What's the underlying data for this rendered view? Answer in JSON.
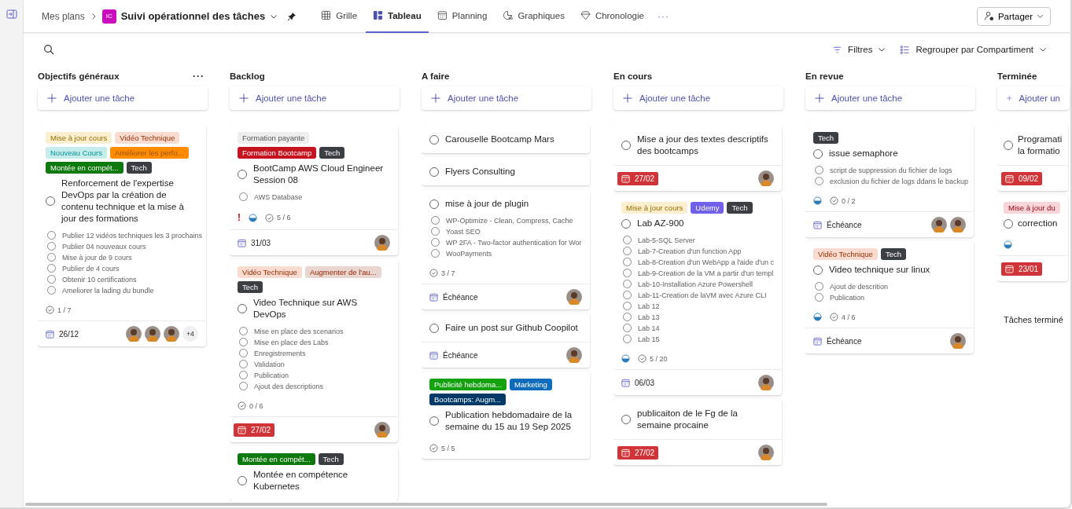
{
  "header": {
    "breadcrumb": "Mes plans",
    "plan_badge": "IC",
    "plan_title": "Suivi opérationnel des tâches",
    "tabs": [
      {
        "label": "Grille",
        "selected": false
      },
      {
        "label": "Tableau",
        "selected": true
      },
      {
        "label": "Planning",
        "selected": false
      },
      {
        "label": "Graphiques",
        "selected": false
      },
      {
        "label": "Chronologie",
        "selected": false
      }
    ],
    "more": "···",
    "share": "Partager"
  },
  "toolbar": {
    "filters": "Filtres",
    "group": "Regrouper par Compartiment"
  },
  "columns": [
    {
      "title": "Objectifs généraux",
      "menu": "···",
      "add": "Ajouter une tâche",
      "cards": [
        {
          "tags": [
            {
              "label": "Mise à jour cours",
              "color": "#fbefcf"
            },
            {
              "label": "Vidéo Technique",
              "color": "#f9dccf"
            },
            {
              "label": "Nouveau Cours",
              "color": "#c6ecec"
            },
            {
              "label": "Améliorer les perfo...",
              "color": "#ff8c00"
            },
            {
              "label": "Montée en compét...",
              "color": "#0e7a0d"
            },
            {
              "label": "Tech",
              "color": "#3b3f44"
            }
          ],
          "checked": false,
          "title": "Renforcement de l'expertise DevOps par la création de contenu technique et la mise à jour des formations",
          "subtasks": [
            {
              "label": "Publier 12 vidéos techniques les 3 prochains",
              "checked": false
            },
            {
              "label": "Publier 04 nouveaux cours",
              "checked": false
            },
            {
              "label": "Mise à jour de 9 cours",
              "checked": false
            },
            {
              "label": "Publier de 4 cours",
              "checked": false
            },
            {
              "label": "Obtenir 10 certifications",
              "checked": false
            },
            {
              "label": "Ameliorer la lading du bundle",
              "checked": false
            }
          ],
          "in_progress": false,
          "checklist": "1 / 7",
          "due": {
            "label": "26/12",
            "overdue": false
          },
          "avatars": [
            {
              "kind": "picture"
            },
            {
              "kind": "picture"
            },
            {
              "kind": "picture"
            }
          ],
          "more_assignees": "+4"
        }
      ]
    },
    {
      "title": "Backlog",
      "add": "Ajouter une tâche",
      "cards": [
        {
          "tags": [
            {
              "label": "Formation payante",
              "color": "#eeeeee"
            },
            {
              "label": "Formation Bootcamp",
              "color": "#c4141f"
            },
            {
              "label": "Tech",
              "color": "#3b3f44"
            }
          ],
          "checked": false,
          "title": "BootCamp AWS Cloud Engineer Session 08",
          "subtasks": [
            {
              "label": "AWS Database",
              "checked": false
            }
          ],
          "priority": "!",
          "in_progress": true,
          "checklist": "5 / 6",
          "due": {
            "label": "31/03",
            "overdue": false
          },
          "avatars": [
            {
              "kind": "picture"
            }
          ]
        },
        {
          "tags": [
            {
              "label": "Vidéo Technique",
              "color": "#f9dccf"
            },
            {
              "label": "Augmenter de l'au...",
              "color": "#ead6d0"
            },
            {
              "label": "Tech",
              "color": "#3b3f44"
            }
          ],
          "checked": false,
          "title": "Video Technique sur AWS DevOps",
          "subtasks": [
            {
              "label": "Mise en place des scenarios",
              "checked": false
            },
            {
              "label": "Mise en place des Labs",
              "checked": false
            },
            {
              "label": "Enregistrements",
              "checked": false
            },
            {
              "label": "Validation",
              "checked": false
            },
            {
              "label": "Publication",
              "checked": false
            },
            {
              "label": "Ajout des descriptions",
              "checked": false
            }
          ],
          "in_progress": false,
          "checklist": "0 / 6",
          "due": {
            "label": "27/02",
            "overdue": true
          },
          "avatars": [
            {
              "kind": "picture"
            }
          ]
        },
        {
          "tags": [
            {
              "label": "Montée en compét...",
              "color": "#0e7a0d"
            },
            {
              "label": "Tech",
              "color": "#3b3f44"
            }
          ],
          "checked": false,
          "title": "Montée en compétence Kubernetes",
          "in_progress": false
        }
      ]
    },
    {
      "title": "A faire",
      "add": "Ajouter une tâche",
      "cards": [
        {
          "checked": false,
          "title": "Carouselle Bootcamp Mars",
          "in_progress": false
        },
        {
          "checked": false,
          "title": "Flyers Consulting",
          "in_progress": false
        },
        {
          "checked": false,
          "title": "mise à jour de plugin",
          "subtasks": [
            {
              "label": "WP-Optimize - Clean, Compress, Cache",
              "checked": false
            },
            {
              "label": "Yoast SEO",
              "checked": false
            },
            {
              "label": "WP 2FA - Two-factor authentication for Wor",
              "checked": false
            },
            {
              "label": "WooPayments",
              "checked": false
            }
          ],
          "in_progress": false,
          "checklist": "3 / 7",
          "due": {
            "label": "Échéance",
            "overdue": false
          },
          "avatars": [
            {
              "kind": "picture"
            }
          ]
        },
        {
          "checked": false,
          "title": "Faire un post sur Github Coopilot",
          "in_progress": false,
          "due": {
            "label": "Échéance",
            "overdue": false
          },
          "avatars": [
            {
              "kind": "picture"
            }
          ]
        },
        {
          "tags": [
            {
              "label": "Publicité hebdoma...",
              "color": "#13a10e"
            },
            {
              "label": "Marketing",
              "color": "#0f6cbd"
            },
            {
              "label": "Bootcamps: Augm...",
              "color": "#003966"
            }
          ],
          "checked": false,
          "title": "Publication hebdomadaire de la semaine du 15 au 19 Sep 2025",
          "in_progress": false,
          "checklist": "5 / 5"
        }
      ]
    },
    {
      "title": "En cours",
      "add": "Ajouter une tâche",
      "cards": [
        {
          "checked": false,
          "title": "Mise a jour des textes descriptifs des bootcamps",
          "in_progress": false,
          "due": {
            "label": "27/02",
            "overdue": true
          },
          "avatars": [
            {
              "kind": "picture"
            }
          ]
        },
        {
          "tags": [
            {
              "label": "Mise à jour cours",
              "color": "#fbefcf"
            },
            {
              "label": "Udemy",
              "color": "#7160e8"
            },
            {
              "label": "Tech",
              "color": "#3b3f44"
            }
          ],
          "checked": false,
          "title": "Lab AZ-900",
          "subtasks": [
            {
              "label": "Lab-5-SQL Server",
              "checked": false
            },
            {
              "label": "Lab-7-Creation d'un function App",
              "checked": false
            },
            {
              "label": "Lab-8-Creation d'un WebApp a l'aide d'un c",
              "checked": false
            },
            {
              "label": "Lab-9-Creation de la VM a partir d'un templ",
              "checked": false
            },
            {
              "label": "Lab-10-Installation Azure Powershell",
              "checked": false
            },
            {
              "label": "Lab-11-Creation de laVM avec Azure CLI",
              "checked": false
            },
            {
              "label": "Lab 12",
              "checked": false
            },
            {
              "label": "Lab 13",
              "checked": false
            },
            {
              "label": "Lab 14",
              "checked": false
            },
            {
              "label": "Lab 15",
              "checked": false
            }
          ],
          "in_progress": true,
          "checklist": "5 / 20",
          "due": {
            "label": "06/03",
            "overdue": false
          },
          "avatars": [
            {
              "kind": "picture"
            }
          ]
        },
        {
          "checked": false,
          "title": "publicaiton de le Fg de la semaine procaine",
          "in_progress": false,
          "due": {
            "label": "27/02",
            "overdue": true
          },
          "avatars": [
            {
              "kind": "picture"
            }
          ]
        }
      ]
    },
    {
      "title": "En revue",
      "add": "Ajouter une tâche",
      "cards": [
        {
          "tags": [
            {
              "label": "Tech",
              "color": "#3b3f44"
            }
          ],
          "checked": false,
          "title": "issue semaphore",
          "subtasks": [
            {
              "label": "script de suppression du fichier de logs",
              "checked": false
            },
            {
              "label": "exclusion du fichier de logs ddans le backup",
              "checked": false
            }
          ],
          "in_progress": true,
          "checklist": "0 / 2",
          "due": {
            "label": "Échéance",
            "overdue": false
          },
          "avatars": [
            {
              "kind": "picture"
            },
            {
              "kind": "picture"
            }
          ]
        },
        {
          "tags": [
            {
              "label": "Vidéo Technique",
              "color": "#f9dccf"
            },
            {
              "label": "Tech",
              "color": "#3b3f44"
            }
          ],
          "checked": false,
          "title": "Video technique sur linux",
          "subtasks": [
            {
              "label": "Ajout de descrition",
              "checked": false
            },
            {
              "label": "Publication",
              "checked": false
            }
          ],
          "in_progress": true,
          "checklist": "4 / 6",
          "due": {
            "label": "Échéance",
            "overdue": false
          },
          "avatars": [
            {
              "kind": "picture"
            }
          ]
        }
      ]
    },
    {
      "title": "Terminée",
      "add": "Ajouter un",
      "cards": [
        {
          "checked": false,
          "title": "Programati la formatio",
          "in_progress": false,
          "due": {
            "label": "09/02",
            "overdue": true
          }
        },
        {
          "tags": [
            {
              "label": "Mise à jour du",
              "color": "#f7d5d8"
            }
          ],
          "checked": false,
          "title": "correction",
          "in_progress": true,
          "due": {
            "label": "23/01",
            "overdue": true
          }
        }
      ],
      "footer": "Tâches terminé"
    }
  ]
}
